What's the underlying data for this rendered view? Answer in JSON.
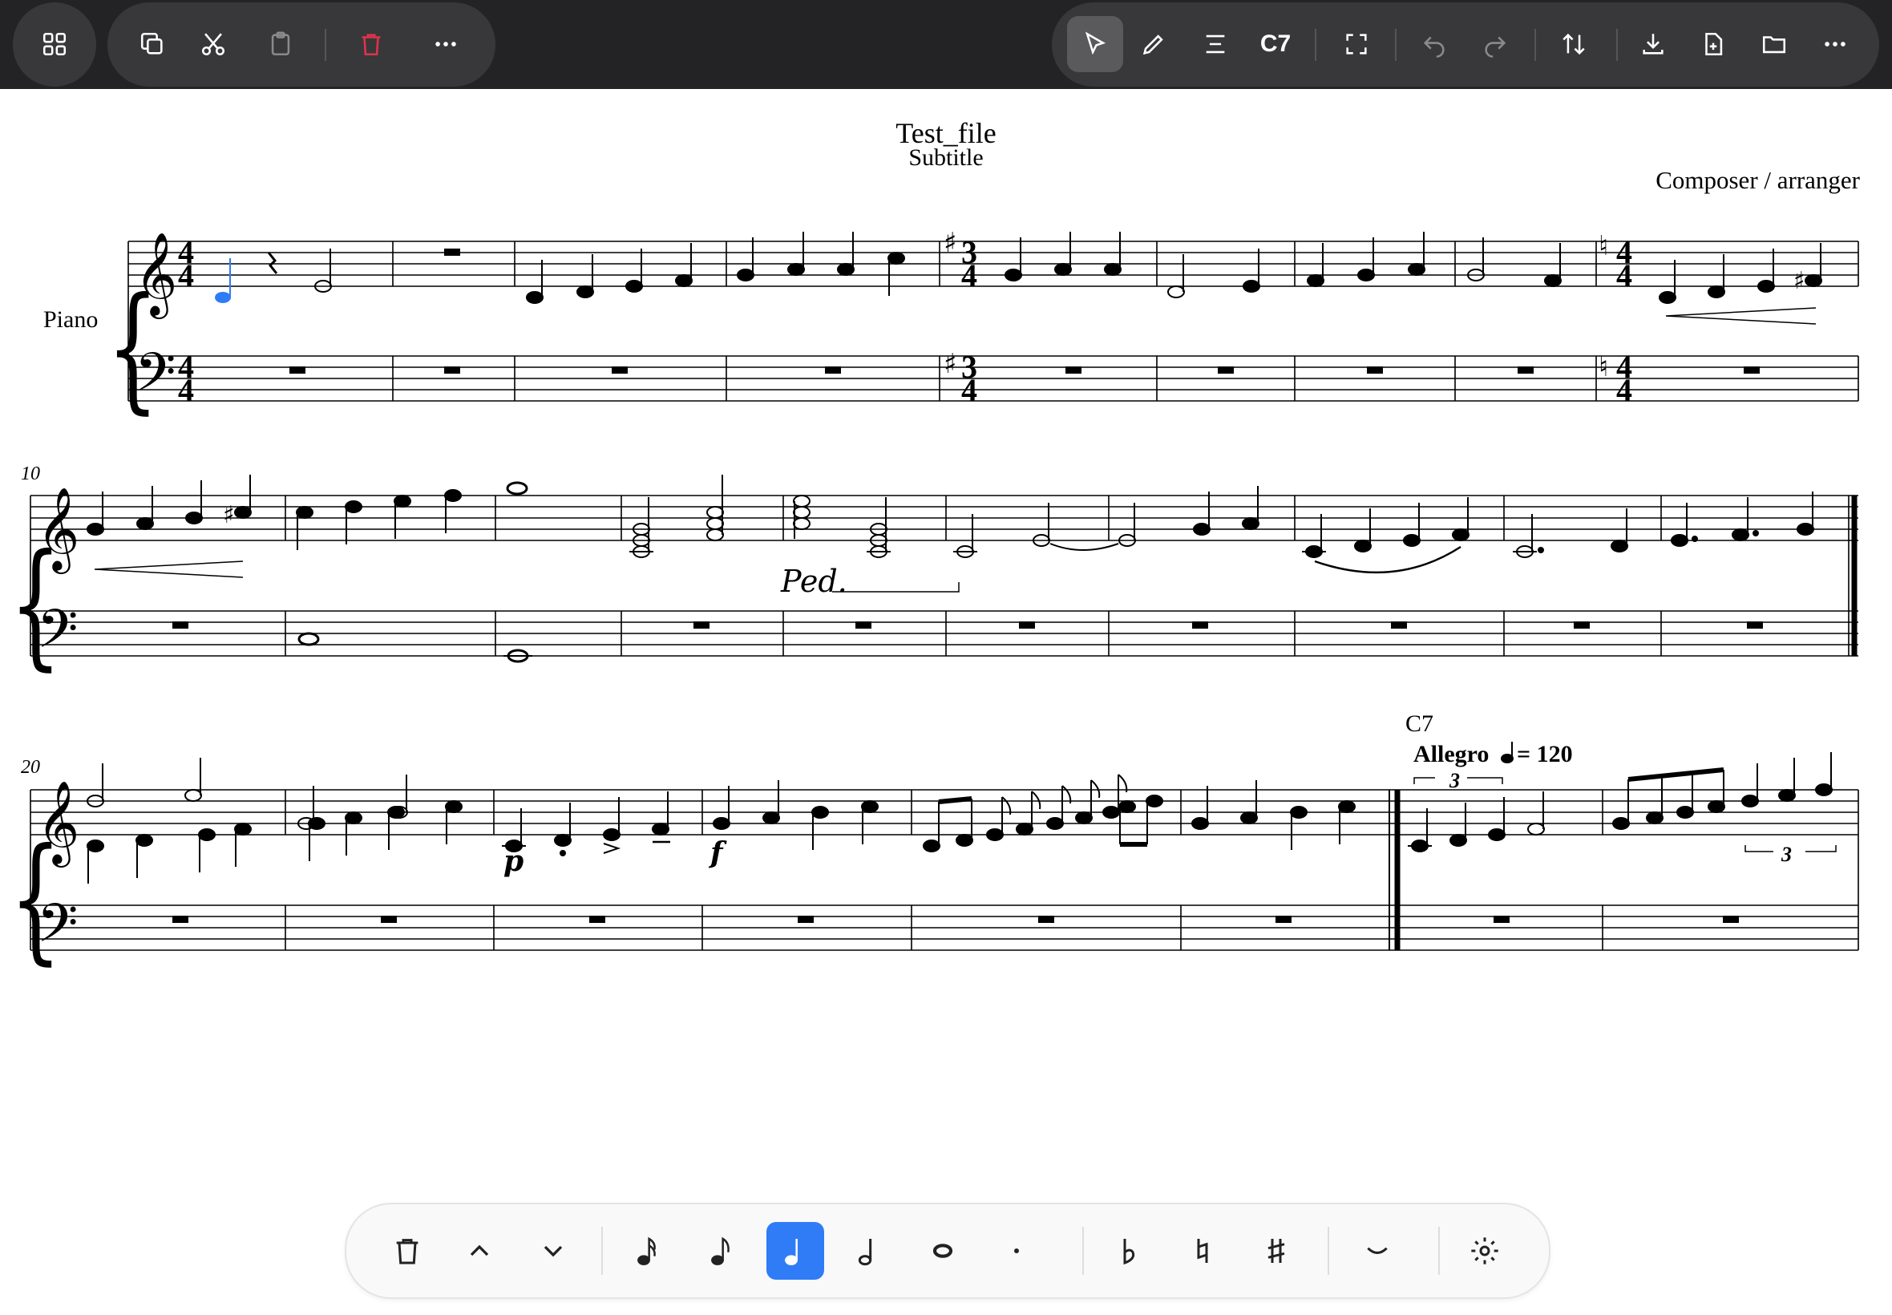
{
  "toolbar": {
    "left_buttons": [
      "apps",
      "copy",
      "cut",
      "paste",
      "delete",
      "more"
    ],
    "right_buttons": [
      "select",
      "pencil",
      "align",
      "chord",
      "fullscreen",
      "undo",
      "redo",
      "swap",
      "download",
      "new-file",
      "open-folder",
      "more"
    ],
    "chord_label": "C7",
    "delete_color": "#e0334a",
    "active_tool": "select"
  },
  "score": {
    "title": "Test_file",
    "subtitle": "Subtitle",
    "composer": "Composer / arranger",
    "instrument": "Piano",
    "measure_numbers": [
      "10",
      "20"
    ],
    "chord_symbol": "C7",
    "tempo_text": "Allegro",
    "tempo_value": "= 120",
    "tuplet": "3",
    "dynamics": [
      "p",
      "f"
    ],
    "pedal": "Ped."
  },
  "palette": {
    "buttons": [
      "delete",
      "up",
      "down",
      "sixteenth",
      "eighth",
      "quarter",
      "half",
      "whole",
      "dot",
      "flat",
      "natural",
      "sharp",
      "tie",
      "settings"
    ],
    "selected": "quarter",
    "accent": "#2f7cf6",
    "selected_note_color": "#2f7cf6"
  }
}
